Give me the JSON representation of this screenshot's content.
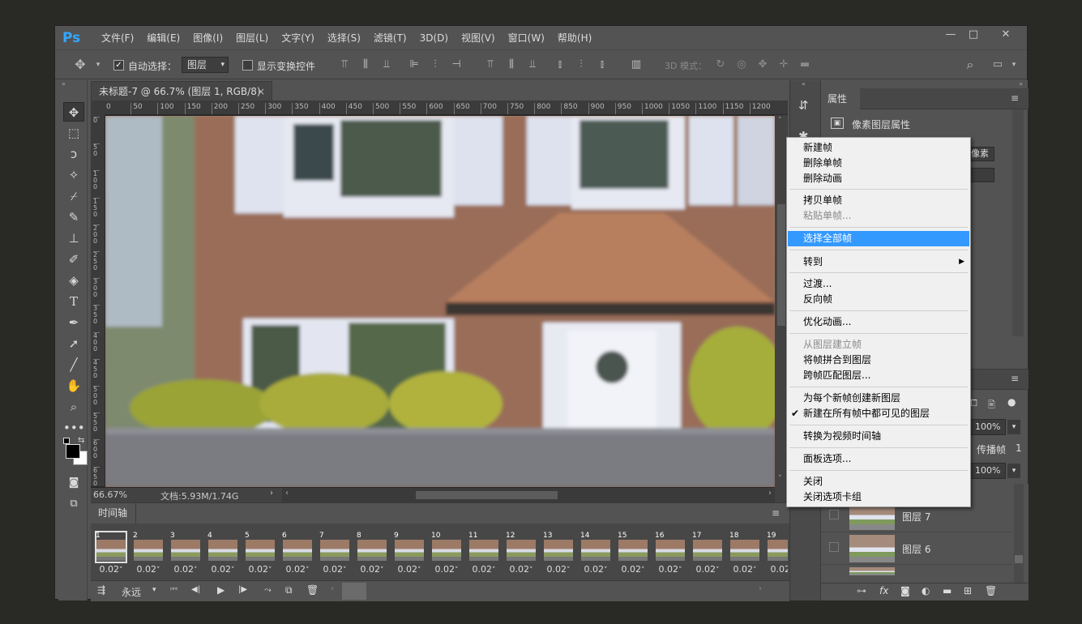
{
  "app": {
    "logo": "Ps"
  },
  "menu": [
    "文件(F)",
    "编辑(E)",
    "图像(I)",
    "图层(L)",
    "文字(Y)",
    "选择(S)",
    "滤镜(T)",
    "3D(D)",
    "视图(V)",
    "窗口(W)",
    "帮助(H)"
  ],
  "window_buttons": {
    "minimize": "—",
    "maximize": "□",
    "close": "✕"
  },
  "options": {
    "auto_select_label": "自动选择：",
    "auto_select_value": "图层",
    "show_transform_label": "显示变换控件",
    "mode_3d_label": "3D 模式："
  },
  "document": {
    "tab_title": "未标题-7 @ 66.7% (图层 1, RGB/8)",
    "close": "×",
    "zoom": "66.67%",
    "doc_size": "文档:5.93M/1.74G",
    "ruler_h": [
      "0",
      "50",
      "100",
      "150",
      "200",
      "250",
      "300",
      "350",
      "400",
      "450",
      "500",
      "550",
      "600",
      "650",
      "700",
      "750",
      "800",
      "850",
      "900",
      "950",
      "1000",
      "1050",
      "1100",
      "1150",
      "1200"
    ],
    "ruler_v": [
      "0",
      "50",
      "100",
      "150",
      "200",
      "250",
      "300",
      "350",
      "400",
      "450",
      "500",
      "550",
      "600",
      "650"
    ]
  },
  "timeline": {
    "title": "时间轴",
    "loop": "永远",
    "frames": [
      {
        "n": "1",
        "d": "0.02"
      },
      {
        "n": "2",
        "d": "0.02"
      },
      {
        "n": "3",
        "d": "0.02"
      },
      {
        "n": "4",
        "d": "0.02"
      },
      {
        "n": "5",
        "d": "0.02"
      },
      {
        "n": "6",
        "d": "0.02"
      },
      {
        "n": "7",
        "d": "0.02"
      },
      {
        "n": "8",
        "d": "0.02"
      },
      {
        "n": "9",
        "d": "0.02"
      },
      {
        "n": "10",
        "d": "0.02"
      },
      {
        "n": "11",
        "d": "0.02"
      },
      {
        "n": "12",
        "d": "0.02"
      },
      {
        "n": "13",
        "d": "0.02"
      },
      {
        "n": "14",
        "d": "0.02"
      },
      {
        "n": "15",
        "d": "0.02"
      },
      {
        "n": "16",
        "d": "0.02"
      },
      {
        "n": "17",
        "d": "0.02"
      },
      {
        "n": "18",
        "d": "0.02"
      },
      {
        "n": "19",
        "d": "0.02"
      }
    ],
    "selected_frame": 1
  },
  "properties": {
    "tab": "属性",
    "pixel_layer": "像素图层属性",
    "unit_pixel": "像素"
  },
  "layers": {
    "opacity": "100%",
    "fill": "100%",
    "propagate": "传播帧",
    "propagate_value": "1",
    "rows": [
      {
        "name": "图层 7"
      },
      {
        "name": "图层 6"
      }
    ]
  },
  "context_menu": {
    "items": [
      {
        "label": "新建帧",
        "state": "normal"
      },
      {
        "label": "删除单帧",
        "state": "normal"
      },
      {
        "label": "删除动画",
        "state": "normal"
      },
      {
        "label": "拷贝单帧",
        "state": "normal"
      },
      {
        "label": "粘贴单帧...",
        "state": "disabled"
      },
      {
        "label": "选择全部帧",
        "state": "highlighted"
      },
      {
        "label": "转到",
        "state": "submenu"
      },
      {
        "label": "过渡...",
        "state": "normal"
      },
      {
        "label": "反向帧",
        "state": "normal"
      },
      {
        "label": "优化动画...",
        "state": "normal"
      },
      {
        "label": "从图层建立帧",
        "state": "disabled"
      },
      {
        "label": "将帧拼合到图层",
        "state": "normal"
      },
      {
        "label": "跨帧匹配图层...",
        "state": "normal"
      },
      {
        "label": "为每个新帧创建新图层",
        "state": "normal"
      },
      {
        "label": "新建在所有帧中都可见的图层",
        "state": "checked"
      },
      {
        "label": "转换为视频时间轴",
        "state": "normal"
      },
      {
        "label": "面板选项...",
        "state": "normal"
      },
      {
        "label": "关闭",
        "state": "normal"
      },
      {
        "label": "关闭选项卡组",
        "state": "normal"
      }
    ],
    "check_glyph": "✔",
    "submenu_glyph": "▶"
  }
}
